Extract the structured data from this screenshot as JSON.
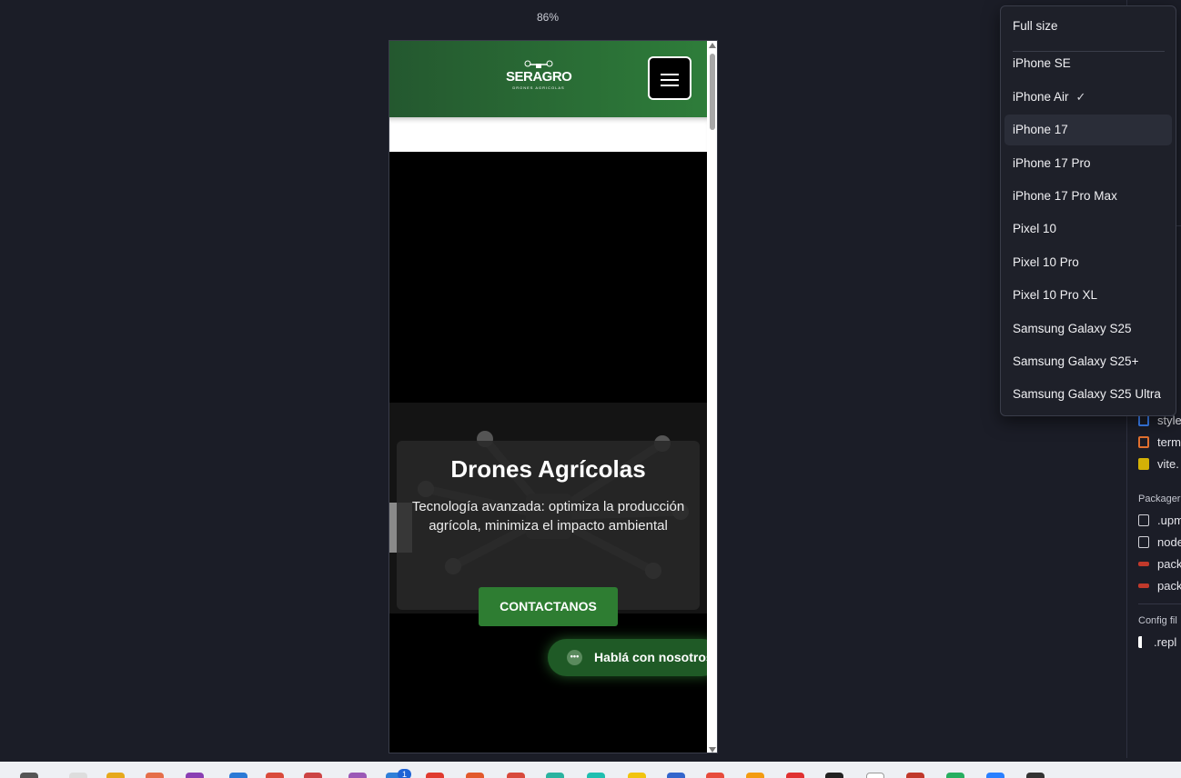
{
  "zoom_label": "86%",
  "site": {
    "logo_text": "SERAGRO",
    "logo_subtitle": "DRONES AGRICOLAS",
    "hero_title": "Drones Agrícolas",
    "hero_subtitle": "Tecnología avanzada: optimiza la producción agrícola, minimiza el impacto ambiental",
    "cta_label": "CONTACTANOS",
    "chat_label": "Hablá con nosotros",
    "colors": {
      "header_green": "#2e7d3a",
      "cta_green": "#2e7d32"
    }
  },
  "device_menu": {
    "items": [
      {
        "label": "Full size"
      },
      {
        "label": "iPhone SE"
      },
      {
        "label": "iPhone Air",
        "selected": true
      },
      {
        "label": "iPhone 17",
        "hovered": true
      },
      {
        "label": "iPhone 17 Pro"
      },
      {
        "label": "iPhone 17 Pro Max"
      },
      {
        "label": "Pixel 10"
      },
      {
        "label": "Pixel 10 Pro"
      },
      {
        "label": "Pixel 10 Pro XL"
      },
      {
        "label": "Samsung Galaxy S25"
      },
      {
        "label": "Samsung Galaxy S25+"
      },
      {
        "label": "Samsung Galaxy S25 Ultra"
      }
    ]
  },
  "side_panel": {
    "files": [
      {
        "label": "style",
        "icon": "css-file-icon",
        "color": "#3b82f6"
      },
      {
        "label": "term",
        "icon": "html-file-icon",
        "color": "#e0702f"
      },
      {
        "label": "vite.",
        "icon": "js-file-icon",
        "color": "#d4b106"
      }
    ],
    "packager_heading": "Packager",
    "packager_items": [
      {
        "label": ".upm",
        "icon": "folder-icon"
      },
      {
        "label": "node",
        "icon": "folder-icon"
      },
      {
        "label": "pack",
        "icon": "npm-icon"
      },
      {
        "label": "pack",
        "icon": "npm-icon"
      }
    ],
    "config_heading": "Config fil",
    "config_items": [
      {
        "label": ".repl",
        "icon": "replit-icon"
      }
    ]
  },
  "dock": {
    "badge": "1"
  }
}
